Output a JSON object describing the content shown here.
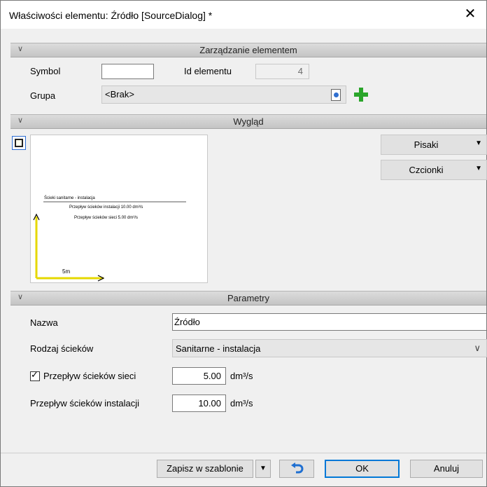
{
  "window": {
    "title": "Właściwości elementu: Źródło [SourceDialog] *",
    "close_glyph": "✕"
  },
  "sections": {
    "management": "Zarządzanie elementem",
    "appearance": "Wygląd",
    "parameters": "Parametry"
  },
  "management": {
    "symbol_label": "Symbol",
    "symbol_value": "",
    "id_label": "Id elementu",
    "id_value": "4",
    "group_label": "Grupa",
    "group_value": "<Brak>"
  },
  "appearance": {
    "pens_label": "Pisaki",
    "fonts_label": "Czcionki",
    "preview": {
      "title": "Ścieki sanitarne - instalacja",
      "line1": "Przepływ ścieków instalacji 10.00 dm³/s",
      "line2": "Przepływ ścieków sieci 5.00 dm³/s",
      "scale": "5m"
    }
  },
  "parameters": {
    "name_label": "Nazwa",
    "name_value": "Źródło",
    "type_label": "Rodzaj ścieków",
    "type_value": "Sanitarne - instalacja",
    "network_flow_label": "Przepływ ścieków sieci",
    "network_flow_checked": true,
    "network_flow_value": "5.00",
    "network_flow_unit": "dm³/s",
    "install_flow_label": "Przepływ ścieków instalacji",
    "install_flow_value": "10.00",
    "install_flow_unit": "dm³/s"
  },
  "footer": {
    "save_template": "Zapisz w szablonie",
    "ok": "OK",
    "cancel": "Anuluj"
  },
  "colors": {
    "accent": "#0078d7",
    "add_green": "#2aa52a",
    "axis_yellow": "#e6d800"
  }
}
